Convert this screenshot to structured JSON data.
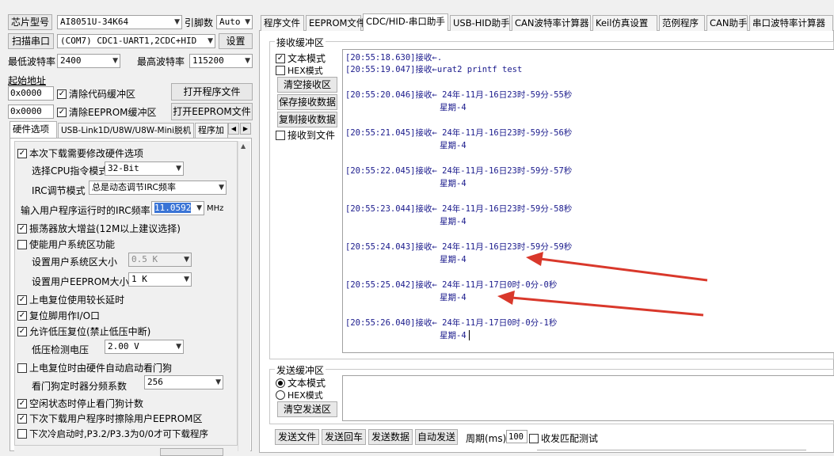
{
  "left": {
    "chip_label": "芯片型号",
    "chip_value": "AI8051U-34K64",
    "pin_label": "引脚数",
    "pin_value": "Auto",
    "scan_button": "扫描串口",
    "port_value": "(COM7) CDC1-UART1,2CDC+HID",
    "settings_button": "设置",
    "min_baud_label": "最低波特率",
    "min_baud_value": "2400",
    "max_baud_label": "最高波特率",
    "max_baud_value": "115200",
    "start_addr_label": "起始地址",
    "addr1": "0x0000",
    "clear_code_label": "清除代码缓冲区",
    "open_prog_button": "打开程序文件",
    "addr2": "0x0000",
    "clear_eeprom_label": "清除EEPROM缓冲区",
    "open_eeprom_button": "打开EEPROM文件",
    "tabs": [
      "硬件选项",
      "USB-Link1D/U8W/U8W-Mini脱机",
      "程序加"
    ],
    "opt_modify_hw": "本次下载需要修改硬件选项",
    "cpu_mode_label": "选择CPU指令模式",
    "cpu_mode_value": "32-Bit",
    "irc_mode_label": "IRC调节模式",
    "irc_mode_value": "总是动态调节IRC频率",
    "irc_freq_label": "输入用户程序运行时的IRC频率",
    "irc_freq_value": "11.0592",
    "irc_unit": "MHz",
    "osc_gain": "振荡器放大增益(12M以上建议选择)",
    "user_sys_enable": "使能用户系统区功能",
    "user_sys_size_label": "设置用户系统区大小",
    "user_sys_size_value": "0.5 K",
    "user_eeprom_label": "设置用户EEPROM大小",
    "user_eeprom_value": "1   K",
    "opt_reset_delay": "上电复位使用较长延时",
    "opt_reset_io": "复位脚用作I/O口",
    "opt_lvr": "允许低压复位(禁止低压中断)",
    "lvd_label": "低压检测电压",
    "lvd_value": "2.00 V",
    "opt_wdt": "上电复位时由硬件自动启动看门狗",
    "wdt_div_label": "看门狗定时器分频系数",
    "wdt_div_value": "256",
    "opt_idle_wdt": "空闲状态时停止看门狗计数",
    "opt_erase_eeprom": "下次下载用户程序时擦除用户EEPROM区",
    "opt_next_p32": "下次冷启动时,P3.2/P3.3为0/0才可下载程序"
  },
  "right": {
    "tabs": [
      "程序文件",
      "EEPROM文件",
      "CDC/HID-串口助手",
      "USB-HID助手",
      "CAN波特率计算器",
      "Keil仿真设置",
      "范例程序",
      "CAN助手",
      "串口波特率计算器"
    ],
    "rx_group": "接收缓冲区",
    "rx_text_mode": "文本模式",
    "rx_hex_mode": "HEX模式",
    "rx_clear": "清空接收区",
    "rx_save": "保存接收数据",
    "rx_copy": "复制接收数据",
    "rx_to_file": "接收到文件",
    "log": [
      {
        "a": "[20:55:18.630]接收←.",
        "b": ""
      },
      {
        "a": "[20:55:19.047]接收←urat2 printf test",
        "b": ""
      },
      {
        "a": "[20:55:20.046]接收← 24年-11月-16日23时-59分-55秒",
        "b": "星期-4"
      },
      {
        "a": "[20:55:21.045]接收← 24年-11月-16日23时-59分-56秒",
        "b": "星期-4"
      },
      {
        "a": "[20:55:22.045]接收← 24年-11月-16日23时-59分-57秒",
        "b": "星期-4"
      },
      {
        "a": "[20:55:23.044]接收← 24年-11月-16日23时-59分-58秒",
        "b": "星期-4"
      },
      {
        "a": "[20:55:24.043]接收← 24年-11月-16日23时-59分-59秒",
        "b": "星期-4"
      },
      {
        "a": "[20:55:25.042]接收← 24年-11月-17日0时-0分-0秒",
        "b": "星期-4"
      },
      {
        "a": "[20:55:26.040]接收← 24年-11月-17日0时-0分-1秒",
        "b": "星期-4"
      }
    ],
    "tx_group": "发送缓冲区",
    "tx_text_mode": "文本模式",
    "tx_hex_mode": "HEX模式",
    "tx_clear": "清空发送区",
    "send_file": "发送文件",
    "send_enter": "发送回车",
    "send_data": "发送数据",
    "auto_send": "自动发送",
    "period_label": "周期(ms)",
    "period_value": "100",
    "match_test": "收发匹配测试"
  },
  "colors": {
    "arrow": "#d9382b",
    "log_text": "#1a1a8c",
    "selection": "#3a74d6"
  }
}
